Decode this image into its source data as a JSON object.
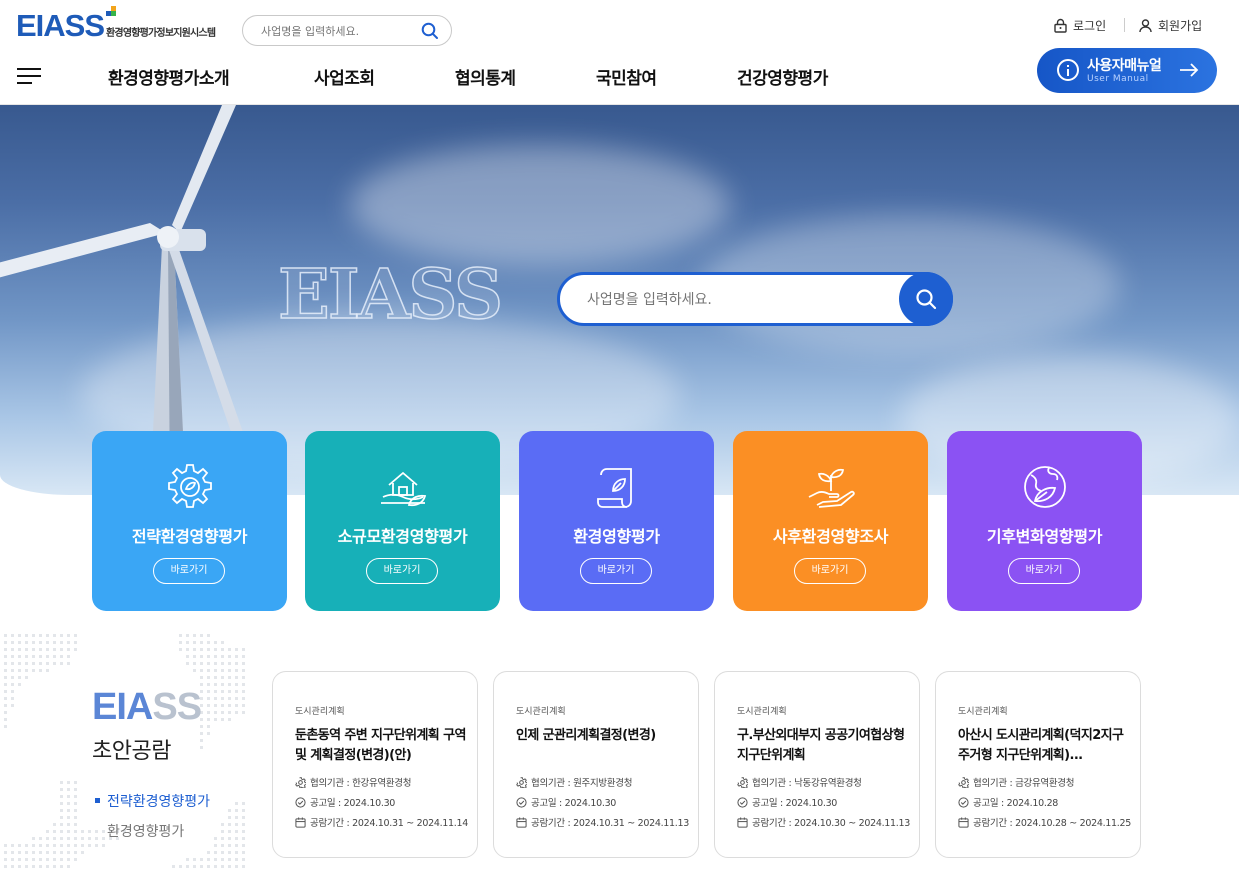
{
  "header": {
    "logo_text": "EIASS",
    "logo_subtitle": "환경영향평가정보지원시스템",
    "search_placeholder": "사업명을 입력하세요.",
    "login_label": "로그인",
    "join_label": "회원가입",
    "nav": [
      "환경영향평가소개",
      "사업조회",
      "협의통계",
      "국민참여",
      "건강영향평가"
    ],
    "manual_title": "사용자매뉴얼",
    "manual_subtitle": "User Manual"
  },
  "hero": {
    "brand": "EIASS",
    "search_placeholder": "사업명을 입력하세요."
  },
  "cards": [
    {
      "title": "전략환경영향평가",
      "button": "바로가기",
      "color": "#3aa6f5",
      "icon": "gear-icon"
    },
    {
      "title": "소규모환경영향평가",
      "button": "바로가기",
      "color": "#17b0b8",
      "icon": "house-leaf-icon"
    },
    {
      "title": "환경영향평가",
      "button": "바로가기",
      "color": "#5a6cf5",
      "icon": "scroll-icon"
    },
    {
      "title": "사후환경영향조사",
      "button": "바로가기",
      "color": "#fb8f24",
      "icon": "hand-plant-icon"
    },
    {
      "title": "기후변화영향평가",
      "button": "바로가기",
      "color": "#8b52f3",
      "icon": "globe-leaf-icon"
    }
  ],
  "section": {
    "brand_part1": "EIA",
    "brand_part2": "SS",
    "title": "초안공람",
    "tab_active": "전략환경영향평가",
    "tab_inactive": "환경영향평가"
  },
  "items": [
    {
      "category": "도시관리계획",
      "title": "둔촌동역 주변 지구단위계획 구역 및 계획결정(변경)(안)",
      "agency": "협의기관 : 한강유역환경청",
      "notice_date": "공고일 : 2024.10.30",
      "period": "공람기간 : 2024.10.31 ~ 2024.11.14"
    },
    {
      "category": "도시관리계획",
      "title": "인제 군관리계획결정(변경)",
      "agency": "협의기관 : 원주지방환경청",
      "notice_date": "공고일 : 2024.10.30",
      "period": "공람기간 : 2024.10.31 ~ 2024.11.13"
    },
    {
      "category": "도시관리계획",
      "title": "구.부산외대부지 공공기여협상형 지구단위계획",
      "agency": "협의기관 : 낙동강유역환경청",
      "notice_date": "공고일 : 2024.10.30",
      "period": "공람기간 : 2024.10.30 ~ 2024.11.13"
    },
    {
      "category": "도시관리계획",
      "title": "아산시 도시관리계획(덕지2지구 주거형 지구단위계획)...",
      "agency": "협의기관 : 금강유역환경청",
      "notice_date": "공고일 : 2024.10.28",
      "period": "공람기간 : 2024.10.28 ~ 2024.11.25"
    }
  ]
}
